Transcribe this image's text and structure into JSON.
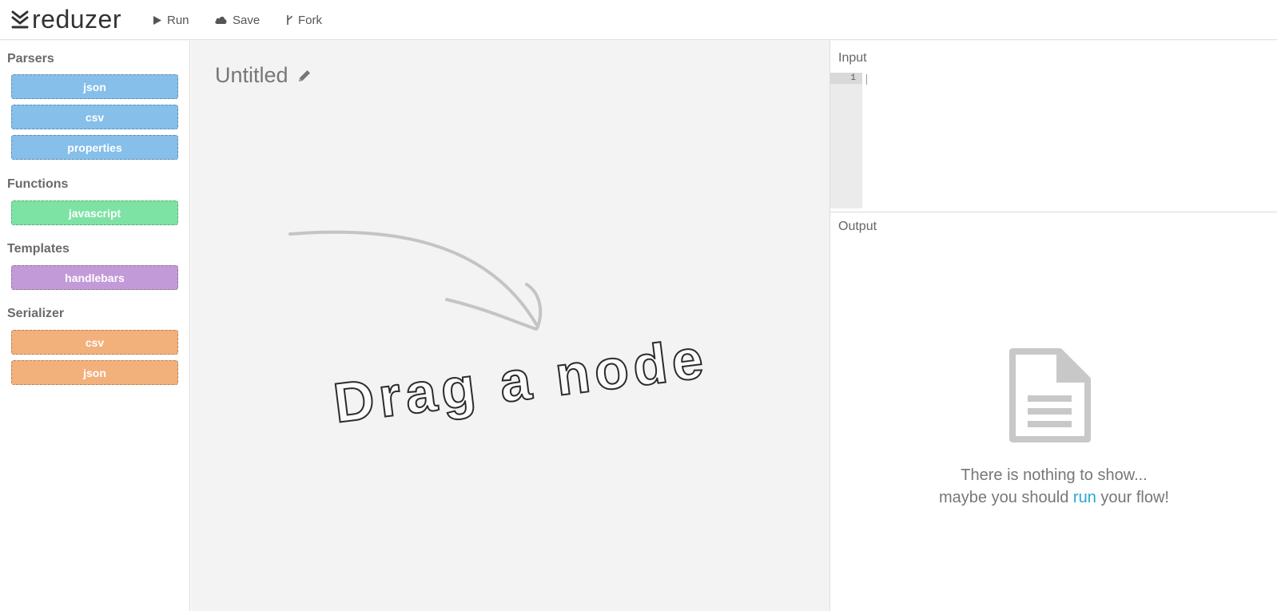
{
  "app": {
    "name": "reduzer"
  },
  "toolbar": {
    "run_label": "Run",
    "save_label": "Save",
    "fork_label": "Fork"
  },
  "sidebar": {
    "sections": [
      {
        "title": "Parsers",
        "nodes": [
          "json",
          "csv",
          "properties"
        ],
        "color": "#85bfea"
      },
      {
        "title": "Functions",
        "nodes": [
          "javascript"
        ],
        "color": "#7de3a4"
      },
      {
        "title": "Templates",
        "nodes": [
          "handlebars"
        ],
        "color": "#c39ad8"
      },
      {
        "title": "Serializer",
        "nodes": [
          "csv",
          "json"
        ],
        "color": "#f2b07b"
      }
    ]
  },
  "canvas": {
    "flow_title": "Untitled",
    "hint_text": "Drag a node"
  },
  "input": {
    "label": "Input",
    "line_number": "1"
  },
  "output": {
    "label": "Output",
    "empty_line1": "There is nothing to show...",
    "empty_line2_prefix": "maybe you should ",
    "empty_link": "run",
    "empty_line2_suffix": " your flow!"
  },
  "colors": {
    "accent": "#2aa7d0",
    "canvas_bg": "#f3f3f3"
  }
}
